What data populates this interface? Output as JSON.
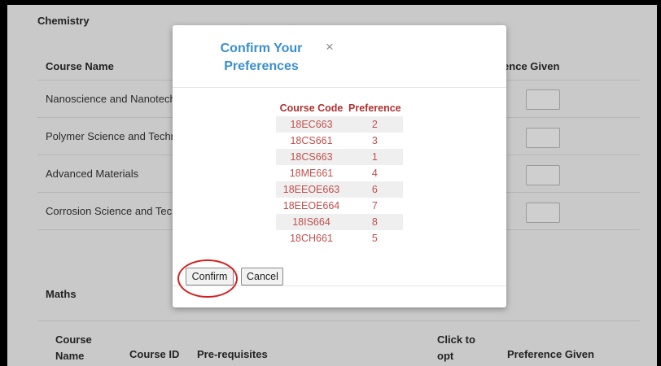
{
  "background_page": {
    "subject_top": "Chemistry",
    "table_top": {
      "headers": {
        "course_name": "Course Name",
        "preference_given_partial": "rence Given"
      },
      "rows": [
        {
          "name": "Nanoscience and Nanotech"
        },
        {
          "name": "Polymer Science and Techn"
        },
        {
          "name": "Advanced Materials"
        },
        {
          "name": "Corrosion Science and Tech"
        }
      ]
    },
    "subject_bottom": "Maths",
    "table_bottom": {
      "headers": {
        "course_name": "Course Name",
        "course_id": "Course ID",
        "prerequisites": "Pre-requisites",
        "click_to_opt": "Click to opt",
        "preference_given": "Preference Given"
      }
    }
  },
  "modal": {
    "title": "Confirm Your Preferences",
    "close_glyph": "×",
    "table": {
      "headers": {
        "course_code": "Course Code",
        "preference": "Preference"
      },
      "rows": [
        {
          "code": "18EC663",
          "pref": "2"
        },
        {
          "code": "18CS661",
          "pref": "3"
        },
        {
          "code": "18CS663",
          "pref": "1"
        },
        {
          "code": "18ME661",
          "pref": "4"
        },
        {
          "code": "18EEOE663",
          "pref": "6"
        },
        {
          "code": "18EEOE664",
          "pref": "7"
        },
        {
          "code": "18IS664",
          "pref": "8"
        },
        {
          "code": "18CH661",
          "pref": "5"
        }
      ]
    },
    "buttons": {
      "confirm": "Confirm",
      "cancel": "Cancel"
    }
  },
  "colors": {
    "title_blue": "#3a8fd0",
    "table_red": "#c0504d",
    "highlight_red": "#d42020",
    "overlay_gray": "#c9c9c9"
  }
}
